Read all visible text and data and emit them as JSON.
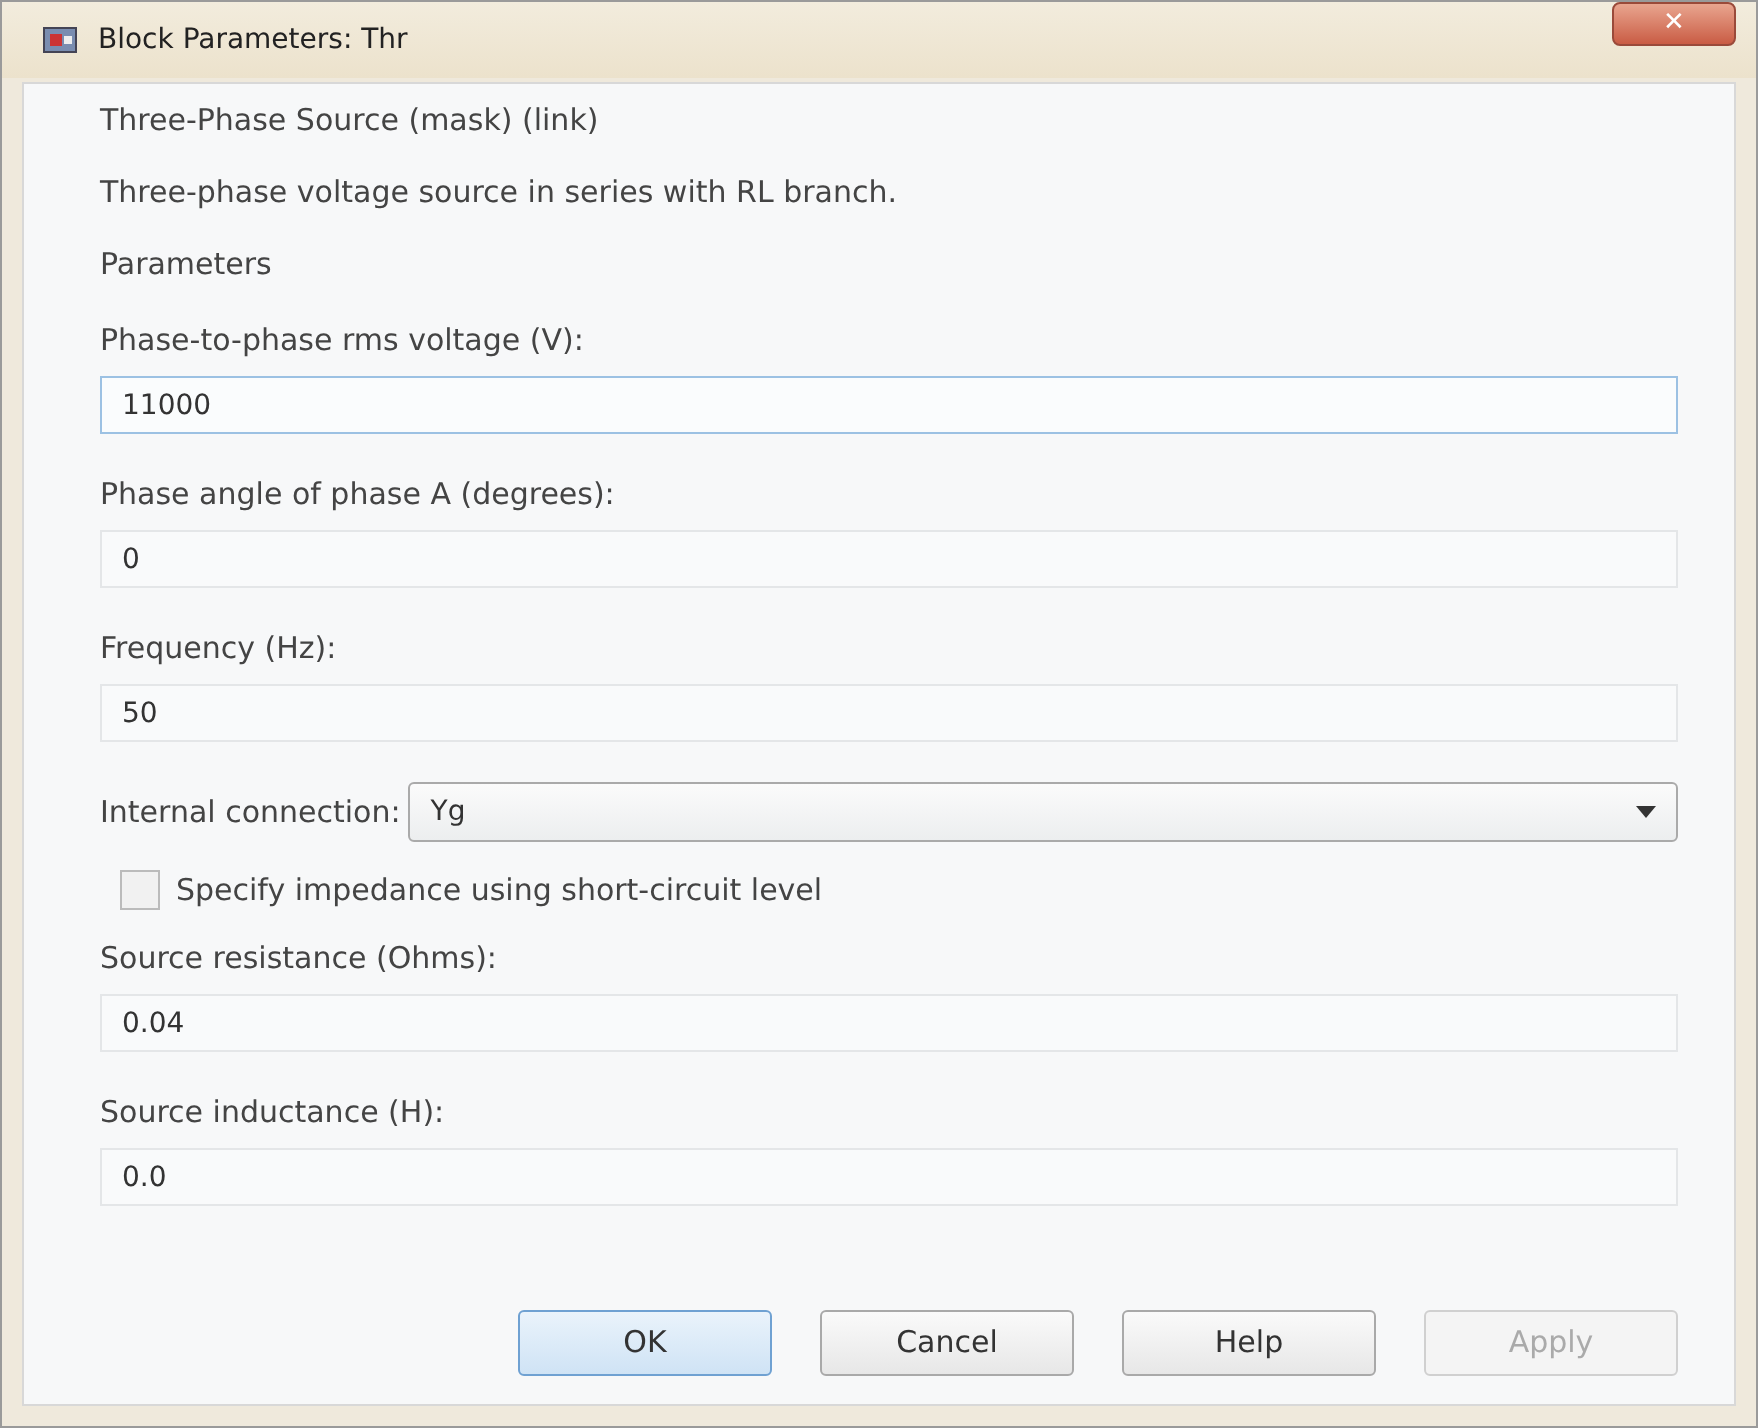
{
  "window": {
    "title": "Block Parameters: Thr",
    "close": "✕"
  },
  "block_title": "Three-Phase Source (mask) (link)",
  "description": "Three-phase voltage source in series with RL branch.",
  "section": "Parameters",
  "parameters": [
    {
      "kind": "text",
      "label": "Phase-to-phase rms voltage (V):",
      "value": "11000",
      "focused": true
    },
    {
      "kind": "text",
      "label": "Phase angle of phase A (degrees):",
      "value": "0",
      "focused": false
    },
    {
      "kind": "text",
      "label": "Frequency (Hz):",
      "value": "50",
      "focused": false
    },
    {
      "kind": "select",
      "label": "Internal connection:",
      "value": "Yg"
    },
    {
      "kind": "checkbox",
      "label": "Specify impedance using short-circuit level",
      "checked": false
    },
    {
      "kind": "text",
      "label": "Source resistance (Ohms):",
      "value": "0.04",
      "focused": false
    },
    {
      "kind": "text",
      "label": "Source inductance (H):",
      "value": "0.0",
      "focused": false
    }
  ],
  "buttons": [
    {
      "label": "OK",
      "default": true,
      "disabled": false
    },
    {
      "label": "Cancel",
      "default": false,
      "disabled": false
    },
    {
      "label": "Help",
      "default": false,
      "disabled": false
    },
    {
      "label": "Apply",
      "default": false,
      "disabled": true
    }
  ]
}
